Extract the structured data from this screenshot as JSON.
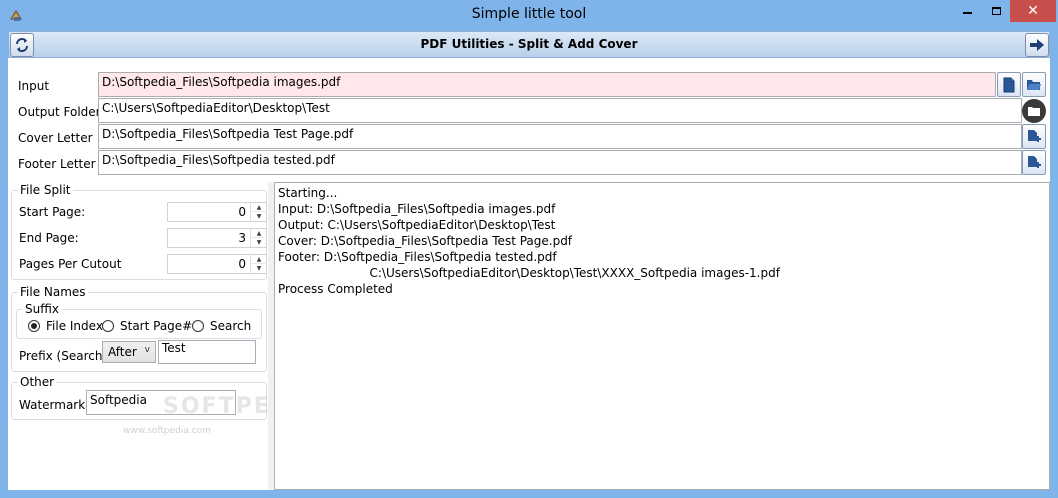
{
  "window": {
    "title": "Simple little tool",
    "close_glyph": "✕"
  },
  "toolbar": {
    "title": "PDF Utilities - Split & Add Cover",
    "back_icon": "refresh-icon",
    "forward_icon": "arrow-right-icon"
  },
  "form": {
    "input": {
      "label": "Input",
      "value": "D:\\Softpedia_Files\\Softpedia images.pdf"
    },
    "output": {
      "label": "Output Folder",
      "value": "C:\\Users\\SoftpediaEditor\\Desktop\\Test"
    },
    "cover": {
      "label": "Cover Letter",
      "value": "D:\\Softpedia_Files\\Softpedia Test Page.pdf"
    },
    "footer": {
      "label": "Footer Letter",
      "value": "D:\\Softpedia_Files\\Softpedia tested.pdf"
    }
  },
  "file_split": {
    "title": "File Split",
    "start_page": {
      "label": "Start Page:",
      "value": "0"
    },
    "end_page": {
      "label": "End Page:",
      "value": "3"
    },
    "pages_per_cutout": {
      "label": "Pages Per Cutout",
      "value": "0"
    }
  },
  "file_names": {
    "title": "File Names",
    "suffix": {
      "title": "Suffix",
      "options": [
        {
          "label": "File Index",
          "checked": true
        },
        {
          "label": "Start Page#",
          "checked": false
        },
        {
          "label": "Search",
          "checked": false
        }
      ]
    },
    "prefix": {
      "label": "Prefix (Search):",
      "mode": "After",
      "value": "Test"
    }
  },
  "other": {
    "title": "Other",
    "watermark": {
      "label": "Watermark:",
      "value": "Softpedia"
    }
  },
  "log": [
    "Starting...",
    "Input: D:\\Softpedia_Files\\Softpedia images.pdf",
    "Output: C:\\Users\\SoftpediaEditor\\Desktop\\Test",
    "Cover: D:\\Softpedia_Files\\Softpedia Test Page.pdf",
    "Footer: D:\\Softpedia_Files\\Softpedia tested.pdf",
    "                        C:\\Users\\SoftpediaEditor\\Desktop\\Test\\XXXX_Softpedia images-1.pdf",
    "Process Completed"
  ],
  "watermark_overlay": {
    "text": "SOFTPEDIA",
    "url": "www.softpedia.com"
  },
  "colors": {
    "title_bar": "#7eb4ea",
    "close_button": "#c7504d",
    "input_highlight": "#ffe7ea"
  }
}
